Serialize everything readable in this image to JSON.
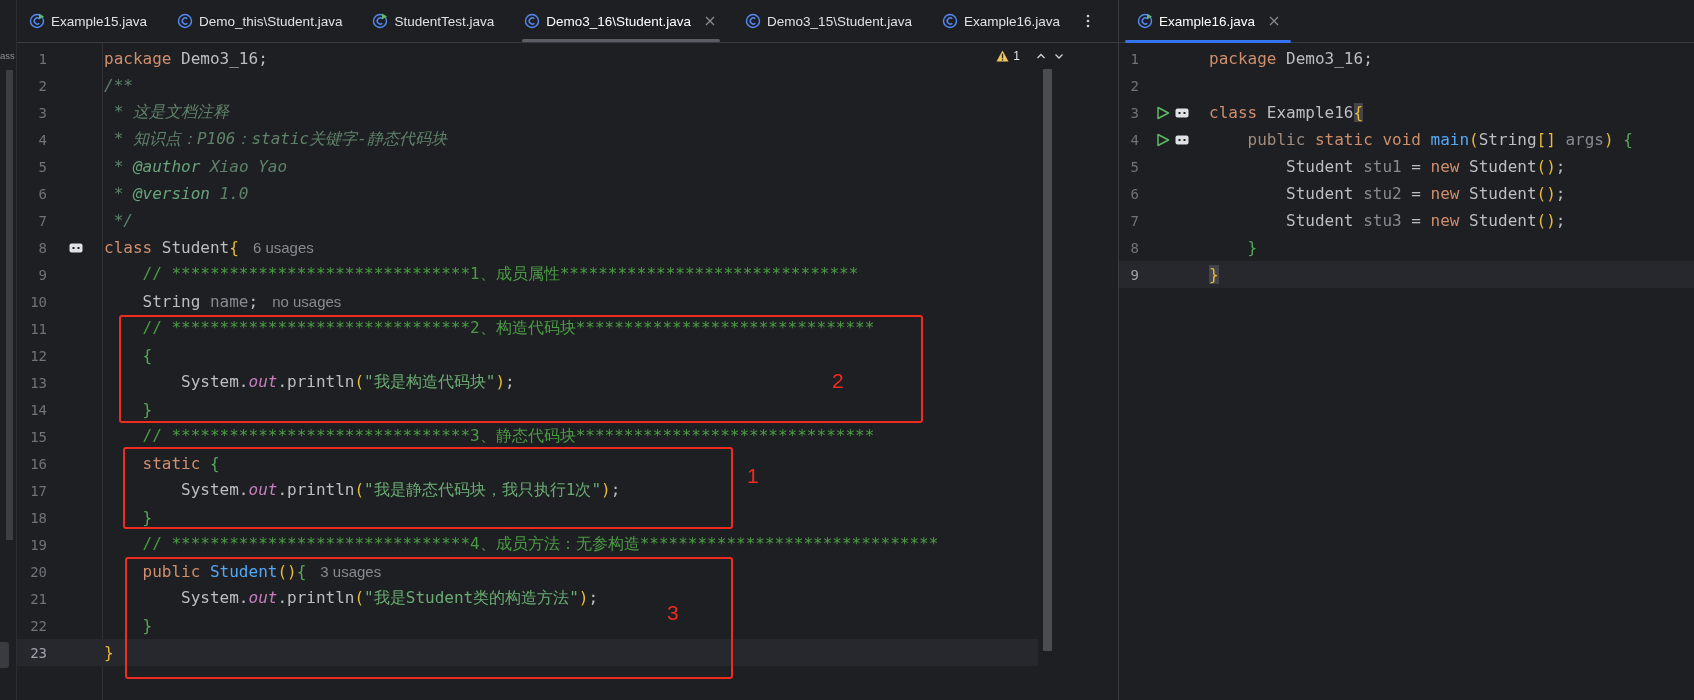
{
  "side_strip": {
    "label": "ass"
  },
  "left_tabs": [
    {
      "label": "Example15.java",
      "kind": "runnable",
      "selected": false
    },
    {
      "label": "Demo_this\\Student.java",
      "kind": "class",
      "selected": false
    },
    {
      "label": "StudentTest.java",
      "kind": "runnable",
      "selected": false
    },
    {
      "label": "Demo3_16\\Student.java",
      "kind": "class",
      "selected": true
    },
    {
      "label": "Demo3_15\\Student.java",
      "kind": "class",
      "selected": false
    },
    {
      "label": "Example16.java",
      "kind": "class",
      "selected": false
    }
  ],
  "left_editor": {
    "problems": {
      "count": "1"
    },
    "blocks": [
      {
        "lines": [
          {
            "number": "1",
            "current": false,
            "tokens": [
              {
                "kind": "keyword",
                "text": "package"
              },
              {
                "kind": "plain",
                "text": " Demo3_16;"
              }
            ]
          },
          {
            "number": "2",
            "current": false,
            "tokens": [
              {
                "kind": "doc",
                "text": "/**"
              }
            ]
          },
          {
            "number": "3",
            "current": false,
            "tokens": [
              {
                "kind": "doc",
                "text": " * 这是文档注释"
              }
            ]
          },
          {
            "number": "4",
            "current": false,
            "tokens": [
              {
                "kind": "doc",
                "text": " * 知识点：P106：static关键字-静态代码块"
              }
            ]
          },
          {
            "number": "5",
            "current": false,
            "tokens": [
              {
                "kind": "doc",
                "text": " * "
              },
              {
                "kind": "doctag",
                "text": "@author"
              },
              {
                "kind": "doc",
                "text": " Xiao Yao"
              }
            ]
          },
          {
            "number": "6",
            "current": false,
            "tokens": [
              {
                "kind": "doc",
                "text": " * "
              },
              {
                "kind": "doctag",
                "text": "@version"
              },
              {
                "kind": "doc",
                "text": " 1.0"
              }
            ]
          },
          {
            "number": "7",
            "current": false,
            "tokens": [
              {
                "kind": "doc",
                "text": " */"
              }
            ]
          },
          {
            "number": "8",
            "current": false,
            "has_marker": true,
            "tokens": [
              {
                "kind": "keyword",
                "text": "class"
              },
              {
                "kind": "plain",
                "text": " Student"
              },
              {
                "kind": "brace",
                "text": "{"
              }
            ],
            "hint": "6 usages"
          },
          {
            "number": "9",
            "current": false,
            "tokens": [
              {
                "kind": "comment",
                "text": "    // *******************************1、成员属性*******************************"
              }
            ]
          },
          {
            "number": "10",
            "current": false,
            "tokens": [
              {
                "kind": "plain",
                "text": "    String "
              },
              {
                "kind": "unused",
                "text": "name"
              },
              {
                "kind": "plain",
                "text": ";"
              }
            ],
            "hint": "no usages"
          }
        ]
      },
      {
        "annotation": "2",
        "lines": [
          {
            "number": "11",
            "current": false,
            "tokens": [
              {
                "kind": "comment",
                "text": "    // *******************************2、构造代码块*******************************"
              }
            ]
          },
          {
            "number": "12",
            "current": false,
            "tokens": [
              {
                "kind": "brace2",
                "text": "    {"
              }
            ]
          },
          {
            "number": "13",
            "current": false,
            "tokens": [
              {
                "kind": "plain",
                "text": "        System."
              },
              {
                "kind": "field",
                "text": "out"
              },
              {
                "kind": "plain",
                "text": ".println"
              },
              {
                "kind": "paren",
                "text": "("
              },
              {
                "kind": "string",
                "text": "\"我是构造代码块\""
              },
              {
                "kind": "paren",
                "text": ")"
              },
              {
                "kind": "plain",
                "text": ";"
              }
            ]
          },
          {
            "number": "14",
            "current": false,
            "tokens": [
              {
                "kind": "brace2",
                "text": "    }"
              }
            ]
          }
        ]
      },
      {
        "lines": [
          {
            "number": "15",
            "current": false,
            "tokens": [
              {
                "kind": "comment",
                "text": "    // *******************************3、静态代码块*******************************"
              }
            ]
          }
        ]
      },
      {
        "annotation": "1",
        "lines": [
          {
            "number": "16",
            "current": false,
            "tokens": [
              {
                "kind": "keyword",
                "text": "    static"
              },
              {
                "kind": "brace2",
                "text": " {"
              }
            ]
          },
          {
            "number": "17",
            "current": false,
            "tokens": [
              {
                "kind": "plain",
                "text": "        System."
              },
              {
                "kind": "field",
                "text": "out"
              },
              {
                "kind": "plain",
                "text": ".println"
              },
              {
                "kind": "paren",
                "text": "("
              },
              {
                "kind": "string",
                "text": "\"我是静态代码块，我只执行1次\""
              },
              {
                "kind": "paren",
                "text": ")"
              },
              {
                "kind": "plain",
                "text": ";"
              }
            ]
          },
          {
            "number": "18",
            "current": false,
            "tokens": [
              {
                "kind": "brace2",
                "text": "    }"
              }
            ]
          }
        ]
      },
      {
        "lines": [
          {
            "number": "19",
            "current": false,
            "tokens": [
              {
                "kind": "comment",
                "text": "    // *******************************4、成员方法：无参构造*******************************"
              }
            ]
          }
        ]
      },
      {
        "annotation": "3",
        "lines": [
          {
            "number": "20",
            "current": false,
            "tokens": [
              {
                "kind": "keyword",
                "text": "    public"
              },
              {
                "kind": "method",
                "text": " Student"
              },
              {
                "kind": "paren",
                "text": "()"
              },
              {
                "kind": "brace2",
                "text": "{"
              }
            ],
            "hint": "3 usages"
          },
          {
            "number": "21",
            "current": false,
            "tokens": [
              {
                "kind": "plain",
                "text": "        System."
              },
              {
                "kind": "field",
                "text": "out"
              },
              {
                "kind": "plain",
                "text": ".println"
              },
              {
                "kind": "paren",
                "text": "("
              },
              {
                "kind": "string",
                "text": "\"我是Student类的构造方法\""
              },
              {
                "kind": "paren",
                "text": ")"
              },
              {
                "kind": "plain",
                "text": ";"
              }
            ]
          },
          {
            "number": "22",
            "current": false,
            "tokens": [
              {
                "kind": "brace2",
                "text": "    }"
              }
            ]
          }
        ]
      },
      {
        "lines": [
          {
            "number": "23",
            "current": true,
            "tokens": [
              {
                "kind": "brace",
                "text": "}"
              }
            ]
          }
        ]
      }
    ]
  },
  "right_tabs": [
    {
      "label": "Example16.java",
      "kind": "runnable",
      "selected": true
    }
  ],
  "right_editor": {
    "lines": [
      {
        "number": "1",
        "current": false,
        "tokens": [
          {
            "kind": "keyword",
            "text": "package"
          },
          {
            "kind": "plain",
            "text": " Demo3_16;"
          }
        ]
      },
      {
        "number": "2",
        "current": false
      },
      {
        "number": "3",
        "current": false,
        "has_run": true,
        "has_marker": true,
        "tokens": [
          {
            "kind": "keyword",
            "text": "class"
          },
          {
            "kind": "plain",
            "text": " Example16"
          },
          {
            "kind": "match",
            "text": "{"
          }
        ]
      },
      {
        "number": "4",
        "current": false,
        "has_run": true,
        "has_marker": true,
        "tokens": [
          {
            "kind": "dim",
            "text": "    public"
          },
          {
            "kind": "keyword",
            "text": " static void"
          },
          {
            "kind": "method",
            "text": " main"
          },
          {
            "kind": "paren",
            "text": "("
          },
          {
            "kind": "plain",
            "text": "String"
          },
          {
            "kind": "paren",
            "text": "[]"
          },
          {
            "kind": "unused",
            "text": " args"
          },
          {
            "kind": "paren",
            "text": ")"
          },
          {
            "kind": "brace2",
            "text": " {"
          }
        ]
      },
      {
        "number": "5",
        "current": false,
        "tokens": [
          {
            "kind": "plain",
            "text": "        Student "
          },
          {
            "kind": "unused",
            "text": "stu1"
          },
          {
            "kind": "plain",
            "text": " = "
          },
          {
            "kind": "keyword",
            "text": "new"
          },
          {
            "kind": "plain",
            "text": " Student"
          },
          {
            "kind": "paren",
            "text": "()"
          },
          {
            "kind": "plain",
            "text": ";"
          }
        ]
      },
      {
        "number": "6",
        "current": false,
        "tokens": [
          {
            "kind": "plain",
            "text": "        Student "
          },
          {
            "kind": "unused",
            "text": "stu2"
          },
          {
            "kind": "plain",
            "text": " = "
          },
          {
            "kind": "keyword",
            "text": "new"
          },
          {
            "kind": "plain",
            "text": " Student"
          },
          {
            "kind": "paren",
            "text": "()"
          },
          {
            "kind": "plain",
            "text": ";"
          }
        ]
      },
      {
        "number": "7",
        "current": false,
        "tokens": [
          {
            "kind": "plain",
            "text": "        Student "
          },
          {
            "kind": "unused",
            "text": "stu3"
          },
          {
            "kind": "plain",
            "text": " = "
          },
          {
            "kind": "keyword",
            "text": "new"
          },
          {
            "kind": "plain",
            "text": " Student"
          },
          {
            "kind": "paren",
            "text": "()"
          },
          {
            "kind": "plain",
            "text": ";"
          }
        ]
      },
      {
        "number": "8",
        "current": false,
        "tokens": [
          {
            "kind": "brace2",
            "text": "    }"
          }
        ]
      },
      {
        "number": "9",
        "current": true,
        "tokens": [
          {
            "kind": "match",
            "text": "}"
          }
        ]
      }
    ]
  }
}
